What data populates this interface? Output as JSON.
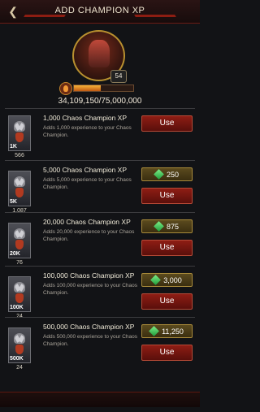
{
  "header": {
    "title": "ADD CHAMPION XP",
    "back_icon": "back-arrow-icon"
  },
  "champion": {
    "level": "54",
    "xp_text": "34,109,150/75,000,000",
    "xp_progress": 0.4548
  },
  "items": [
    {
      "title": "1,000 Chaos Champion XP",
      "desc": "Adds 1,000 experience to your Chaos Champion.",
      "thumb_label": "1K",
      "count": "566",
      "price": null,
      "use": "Use"
    },
    {
      "title": "5,000 Chaos Champion XP",
      "desc": "Adds 5,000 experience to your Chaos Champion.",
      "thumb_label": "5K",
      "count": "1,087",
      "price": "250",
      "use": "Use"
    },
    {
      "title": "20,000 Chaos Champion XP",
      "desc": "Adds 20,000 experience to your Chaos Champion.",
      "thumb_label": "20K",
      "count": "76",
      "price": "875",
      "use": "Use"
    },
    {
      "title": "100,000 Chaos Champion XP",
      "desc": "Adds 100,000 experience to your Chaos Champion.",
      "thumb_label": "100K",
      "count": "24",
      "price": "3,000",
      "use": "Use"
    },
    {
      "title": "500,000 Chaos Champion XP",
      "desc": "Adds 500,000 experience to your Chaos Champion.",
      "thumb_label": "500K",
      "count": "24",
      "price": "11,250",
      "use": "Use"
    }
  ],
  "colors": {
    "accent_red": "#8e1d14",
    "gold_border": "#a88a3a",
    "gem_green": "#1f9b3a"
  }
}
